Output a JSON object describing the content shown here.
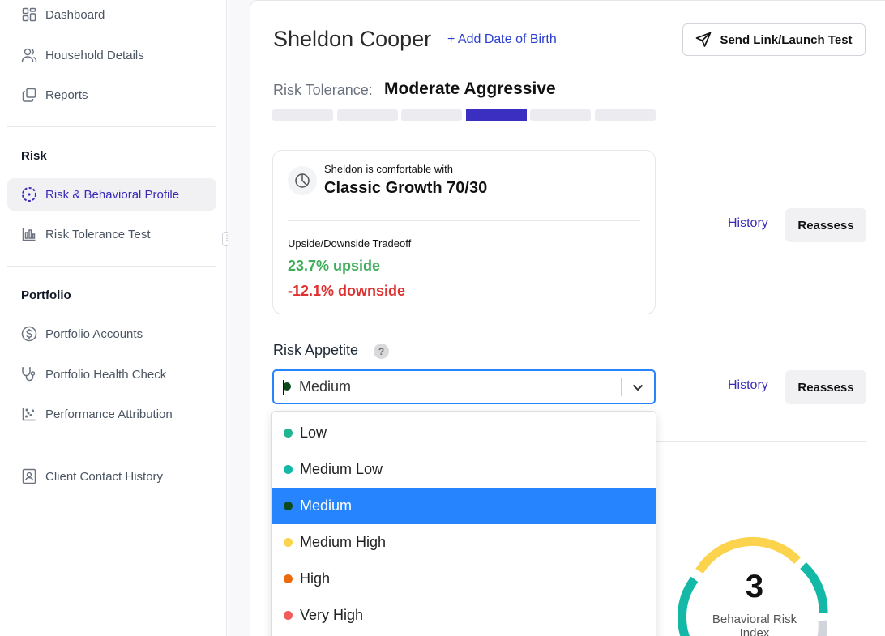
{
  "sidebar": {
    "items": [
      {
        "label": "Dashboard",
        "icon": "grid-icon"
      },
      {
        "label": "Household Details",
        "icon": "users-icon"
      },
      {
        "label": "Reports",
        "icon": "copy-icon"
      }
    ],
    "risk_section": "Risk",
    "risk_items": [
      {
        "label": "Risk & Behavioral Profile",
        "icon": "dashed-circle-icon",
        "active": true
      },
      {
        "label": "Risk Tolerance Test",
        "icon": "bar-chart-icon"
      }
    ],
    "portfolio_section": "Portfolio",
    "portfolio_items": [
      {
        "label": "Portfolio Accounts",
        "icon": "dollar-circle-icon"
      },
      {
        "label": "Portfolio Health Check",
        "icon": "stethoscope-icon"
      },
      {
        "label": "Performance Attribution",
        "icon": "scatter-icon"
      }
    ],
    "other_items": [
      {
        "label": "Client Contact History",
        "icon": "contact-card-icon"
      }
    ]
  },
  "header": {
    "client_name": "Sheldon Cooper",
    "add_dob": "+ Add Date of Birth",
    "send_button": "Send Link/Launch Test"
  },
  "risk_tolerance": {
    "label": "Risk Tolerance:",
    "value": "Moderate Aggressive",
    "levels_total": 6,
    "level_selected": 4
  },
  "portfolio": {
    "comfort_text": "Sheldon is comfortable with",
    "model": "Classic Growth 70/30",
    "tradeoff_label": "Upside/Downside Tradeoff",
    "upside": "23.7% upside",
    "downside": "-12.1% downside"
  },
  "actions": {
    "history_label": "History",
    "reassess_label": "Reassess"
  },
  "risk_appetite": {
    "label": "Risk Appetite",
    "help": "?",
    "selected": "Medium",
    "options": [
      {
        "label": "Low",
        "color": "#1fb58f"
      },
      {
        "label": "Medium Low",
        "color": "#14b8a6"
      },
      {
        "label": "Medium",
        "color": "#0c4a1c",
        "selected": true
      },
      {
        "label": "Medium High",
        "color": "#fcd34d"
      },
      {
        "label": "High",
        "color": "#ea6a0c"
      },
      {
        "label": "Very High",
        "color": "#f25c5c"
      }
    ]
  },
  "behavioral": {
    "score": "3",
    "label": "Behavioral Risk Index"
  },
  "colors": {
    "accent": "#3a2bb8",
    "select_highlight": "#2684ff"
  }
}
